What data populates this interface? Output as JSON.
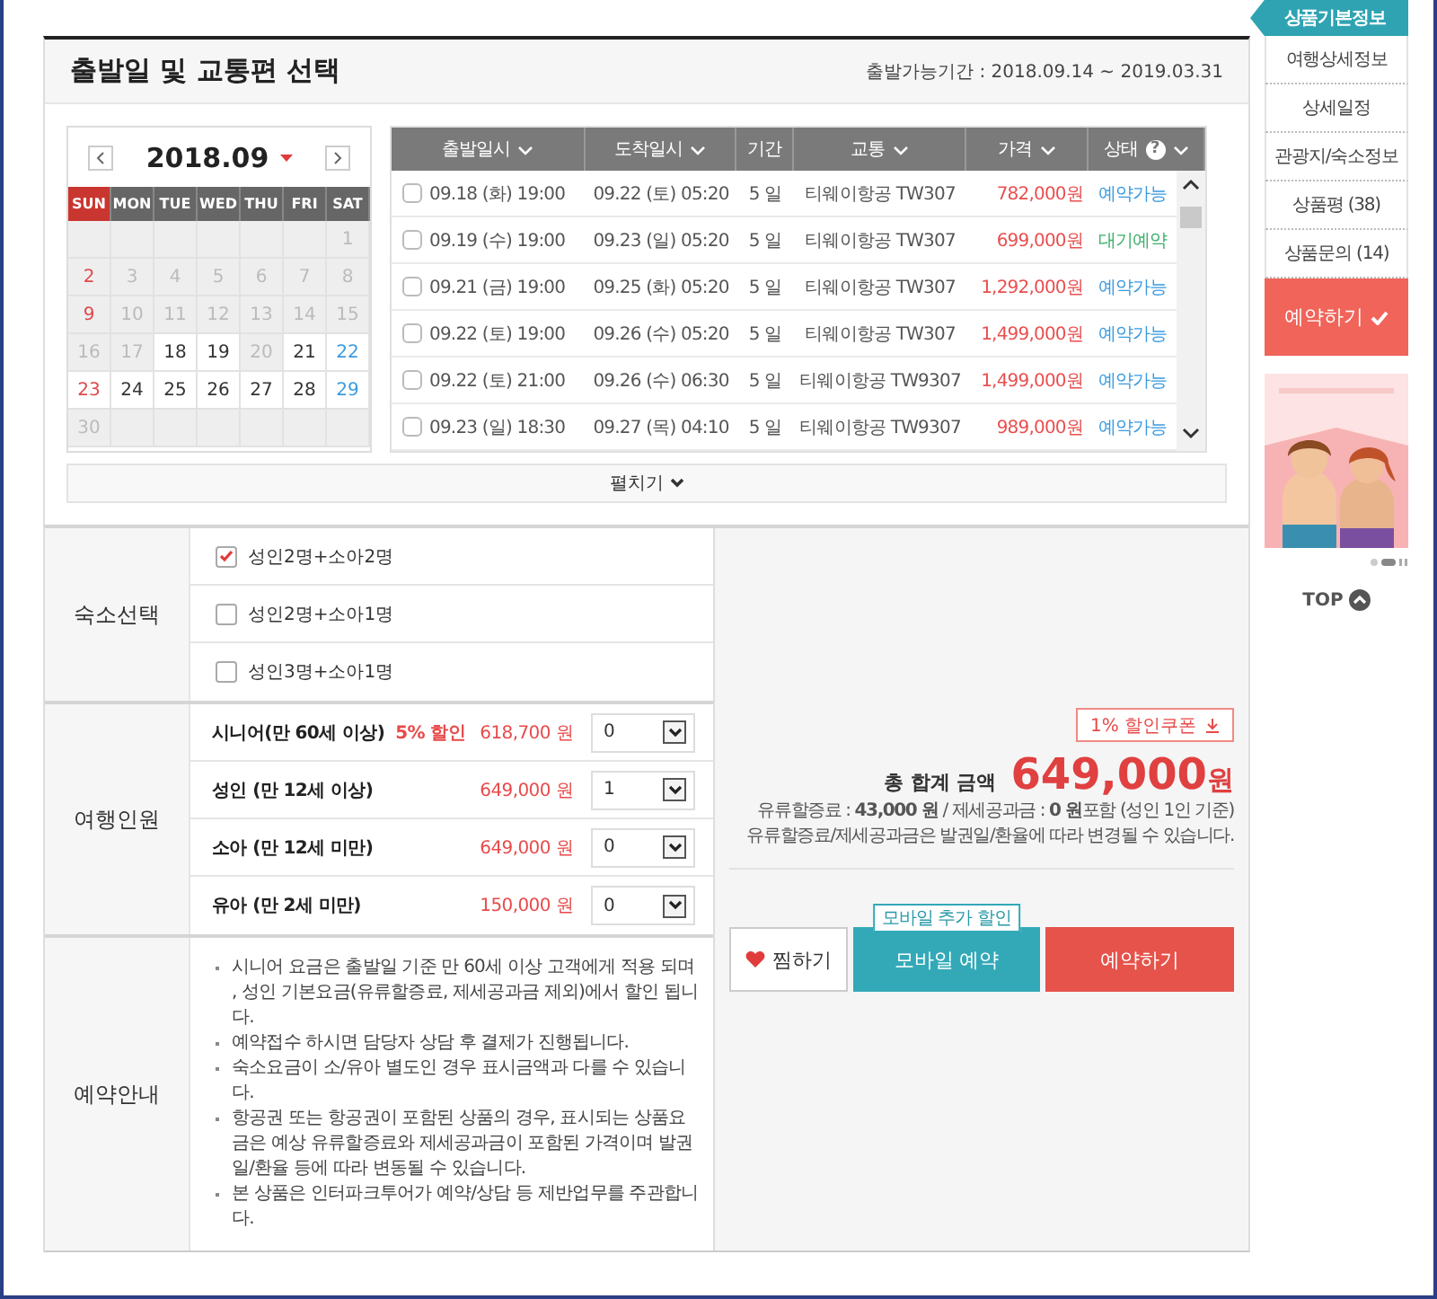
{
  "header": {
    "title": "출발일 및 교통편 선택",
    "period": "출발가능기간 : 2018.09.14 ~ 2019.03.31"
  },
  "calendar": {
    "month": "2018.09",
    "weekdays": [
      {
        "label": "SUN",
        "kind": "sun"
      },
      {
        "label": "MON",
        "kind": "day"
      },
      {
        "label": "TUE",
        "kind": "day"
      },
      {
        "label": "WED",
        "kind": "day"
      },
      {
        "label": "THU",
        "kind": "day"
      },
      {
        "label": "FRI",
        "kind": "day"
      },
      {
        "label": "SAT",
        "kind": "day"
      }
    ],
    "weeks": [
      [
        {
          "day": "1",
          "available": false,
          "kind": "weekday"
        }
      ],
      [
        {
          "day": "2",
          "available": false,
          "kind": "holiday"
        },
        {
          "day": "3",
          "available": false,
          "kind": "weekday"
        },
        {
          "day": "4",
          "available": false,
          "kind": "weekday"
        },
        {
          "day": "5",
          "available": false,
          "kind": "weekday"
        },
        {
          "day": "6",
          "available": false,
          "kind": "weekday"
        },
        {
          "day": "7",
          "available": false,
          "kind": "weekday"
        },
        {
          "day": "8",
          "available": false,
          "kind": "weekday"
        }
      ],
      [
        {
          "day": "9",
          "available": false,
          "kind": "holiday"
        },
        {
          "day": "10",
          "available": false,
          "kind": "weekday"
        },
        {
          "day": "11",
          "available": false,
          "kind": "weekday"
        },
        {
          "day": "12",
          "available": false,
          "kind": "weekday"
        },
        {
          "day": "13",
          "available": false,
          "kind": "weekday"
        },
        {
          "day": "14",
          "available": false,
          "kind": "weekday"
        },
        {
          "day": "15",
          "available": false,
          "kind": "weekday"
        }
      ],
      [
        {
          "day": "16",
          "available": false,
          "kind": "weekday"
        },
        {
          "day": "17",
          "available": false,
          "kind": "weekday"
        },
        {
          "day": "18",
          "available": true,
          "kind": "weekday"
        },
        {
          "day": "19",
          "available": true,
          "kind": "weekday"
        },
        {
          "day": "20",
          "available": false,
          "kind": "weekday"
        },
        {
          "day": "21",
          "available": true,
          "kind": "weekday"
        },
        {
          "day": "22",
          "available": true,
          "kind": "saturday"
        }
      ],
      [
        {
          "day": "23",
          "available": true,
          "kind": "holiday"
        },
        {
          "day": "24",
          "available": true,
          "kind": "weekday"
        },
        {
          "day": "25",
          "available": true,
          "kind": "weekday"
        },
        {
          "day": "26",
          "available": true,
          "kind": "weekday"
        },
        {
          "day": "27",
          "available": true,
          "kind": "weekday"
        },
        {
          "day": "28",
          "available": true,
          "kind": "weekday"
        },
        {
          "day": "29",
          "available": true,
          "kind": "saturday"
        }
      ],
      [
        {
          "day": "30",
          "available": false,
          "kind": "weekday"
        }
      ]
    ]
  },
  "flights": {
    "columns": [
      {
        "label": "출발일시",
        "sortable": true
      },
      {
        "label": "도착일시",
        "sortable": true
      },
      {
        "label": "기간",
        "sortable": false
      },
      {
        "label": "교통",
        "sortable": true
      },
      {
        "label": "가격",
        "sortable": true
      },
      {
        "label": "상태",
        "sortable": true,
        "help": "?"
      }
    ],
    "rows": [
      {
        "checked": false,
        "depart": "09.18 (화) 19:00",
        "arrive": "09.22 (토) 05:20",
        "duration": "5 일",
        "transport": "티웨이항공 TW307",
        "price": "782,000원",
        "status": "예약가능",
        "kind": "available"
      },
      {
        "checked": false,
        "depart": "09.19 (수) 19:00",
        "arrive": "09.23 (일) 05:20",
        "duration": "5 일",
        "transport": "티웨이항공 TW307",
        "price": "699,000원",
        "status": "대기예약",
        "kind": "waitlist"
      },
      {
        "checked": false,
        "depart": "09.21 (금) 19:00",
        "arrive": "09.25 (화) 05:20",
        "duration": "5 일",
        "transport": "티웨이항공 TW307",
        "price": "1,292,000원",
        "status": "예약가능",
        "kind": "available"
      },
      {
        "checked": false,
        "depart": "09.22 (토) 19:00",
        "arrive": "09.26 (수) 05:20",
        "duration": "5 일",
        "transport": "티웨이항공 TW307",
        "price": "1,499,000원",
        "status": "예약가능",
        "kind": "available"
      },
      {
        "checked": false,
        "depart": "09.22 (토) 21:00",
        "arrive": "09.26 (수) 06:30",
        "duration": "5 일",
        "transport": "티웨이항공 TW9307",
        "price": "1,499,000원",
        "status": "예약가능",
        "kind": "available"
      },
      {
        "checked": false,
        "depart": "09.23 (일) 18:30",
        "arrive": "09.27 (목) 04:10",
        "duration": "5 일",
        "transport": "티웨이항공 TW9307",
        "price": "989,000원",
        "status": "예약가능",
        "kind": "available"
      }
    ],
    "expand": "펼치기"
  },
  "lodging": {
    "label": "숙소선택",
    "options": [
      {
        "label": "성인2명+소아2명",
        "checked": true
      },
      {
        "label": "성인2명+소아1명",
        "checked": false
      },
      {
        "label": "성인3명+소아1명",
        "checked": false
      }
    ]
  },
  "travelers": {
    "label": "여행인원",
    "rows": [
      {
        "label": "시니어(만 60세 이상)",
        "discount": "5% 할인",
        "price": "618,700 원",
        "count": "0"
      },
      {
        "label": "성인 (만 12세 이상)",
        "price": "649,000 원",
        "count": "1"
      },
      {
        "label": "소아 (만 12세 미만)",
        "price": "649,000 원",
        "count": "0"
      },
      {
        "label": "유아 (만 2세 미만)",
        "price": "150,000 원",
        "count": "0"
      }
    ]
  },
  "notes": {
    "label": "예약안내",
    "items": [
      "시니어 요금은 출발일 기준 만 60세 이상 고객에게 적용 되며 , 성인 기본요금(유류할증료, 제세공과금 제외)에서 할인 됩니다.",
      "예약접수 하시면 담당자 상담 후 결제가 진행됩니다.",
      "숙소요금이 소/유아 별도인 경우 표시금액과 다를 수 있습니다.",
      "항공권 또는 항공권이 포함된 상품의 경우, 표시되는 상품요금은 예상 유류할증료와 제세공과금이 포함된 가격이며 발권일/환율 등에 따라 변동될 수 있습니다.",
      "본 상품은 인터파크투어가 예약/상담 등 제반업무를 주관합니다."
    ]
  },
  "summary": {
    "coupon": "1% 할인쿠폰",
    "total_label": "총 합계 금액",
    "total": "649,000",
    "currency": "원",
    "fees": [
      "유류할증료 : **43,000 원** / 제세공과금 : **0 원**포함 (성인 1인 기준)",
      "유류할증료/제세공과금은 발권일/환율에 따라 변경될 수 있습니다."
    ]
  },
  "actions": [
    {
      "label": "찜하기",
      "kind": "wish"
    },
    {
      "label": "모바일 예약",
      "kind": "mobile",
      "badge": "모바일 추가 할인"
    },
    {
      "label": "예약하기",
      "kind": "book"
    }
  ],
  "sidebar": {
    "tabs": [
      {
        "label": "상품기본정보",
        "selected": true
      },
      {
        "label": "여행상세정보",
        "selected": false
      },
      {
        "label": "상세일정",
        "selected": false
      },
      {
        "label": "관광지/숙소정보",
        "selected": false
      },
      {
        "label": "상품평 (38)",
        "selected": false
      },
      {
        "label": "상품문의 (14)",
        "selected": false
      }
    ],
    "book": "예약하기",
    "top": "TOP"
  }
}
